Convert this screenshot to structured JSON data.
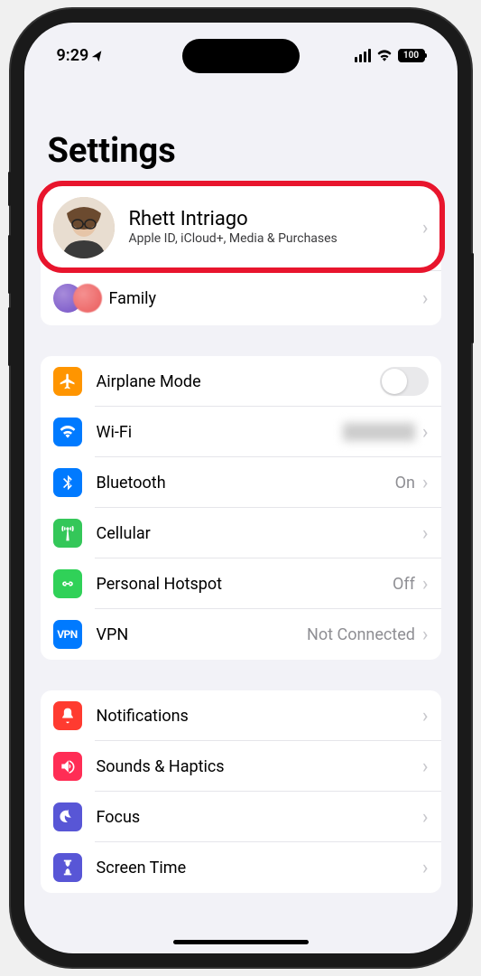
{
  "status": {
    "time": "9:29",
    "battery": "100"
  },
  "page": {
    "title": "Settings"
  },
  "profile": {
    "name": "Rhett Intriago",
    "subtitle": "Apple ID, iCloud+, Media & Purchases"
  },
  "family": {
    "label": "Family"
  },
  "connectivity": {
    "airplane": {
      "label": "Airplane Mode"
    },
    "wifi": {
      "label": "Wi-Fi",
      "value": ""
    },
    "bluetooth": {
      "label": "Bluetooth",
      "value": "On"
    },
    "cellular": {
      "label": "Cellular"
    },
    "hotspot": {
      "label": "Personal Hotspot",
      "value": "Off"
    },
    "vpn": {
      "label": "VPN",
      "value": "Not Connected",
      "badge": "VPN"
    }
  },
  "general": {
    "notifications": {
      "label": "Notifications"
    },
    "sounds": {
      "label": "Sounds & Haptics"
    },
    "focus": {
      "label": "Focus"
    },
    "screentime": {
      "label": "Screen Time"
    }
  }
}
